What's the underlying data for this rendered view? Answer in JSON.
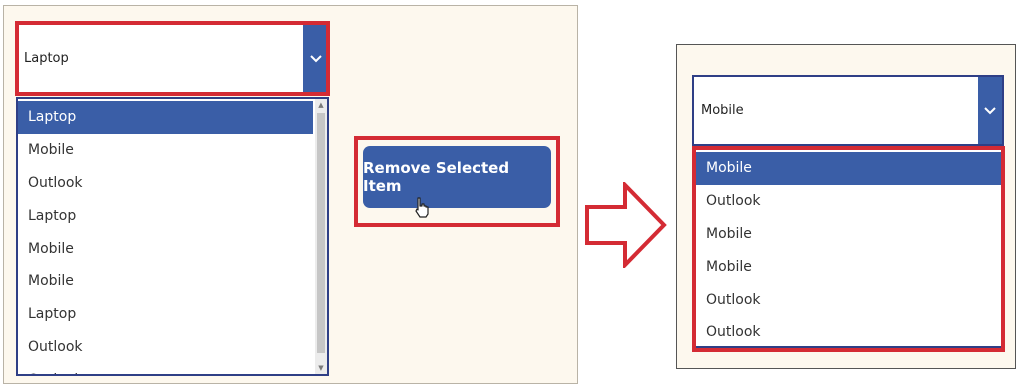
{
  "left_dropdown": {
    "selected_value": "Laptop",
    "items": [
      "Laptop",
      "Mobile",
      "Outlook",
      "Laptop",
      "Mobile",
      "Mobile",
      "Laptop",
      "Outlook",
      "Outlook"
    ],
    "selected_index": 0
  },
  "remove_button": {
    "label": "Remove Selected Item"
  },
  "right_dropdown": {
    "selected_value": "Mobile",
    "items": [
      "Mobile",
      "Outlook",
      "Mobile",
      "Mobile",
      "Outlook",
      "Outlook"
    ],
    "selected_index": 0
  },
  "colors": {
    "accent": "#3a5ea7",
    "highlight": "#d42b34",
    "panel_bg": "#fdf8ee"
  },
  "icons": {
    "dropdown_chevron": "chevron-down-icon",
    "arrow": "arrow-right-icon",
    "cursor": "hand-pointer-icon"
  }
}
